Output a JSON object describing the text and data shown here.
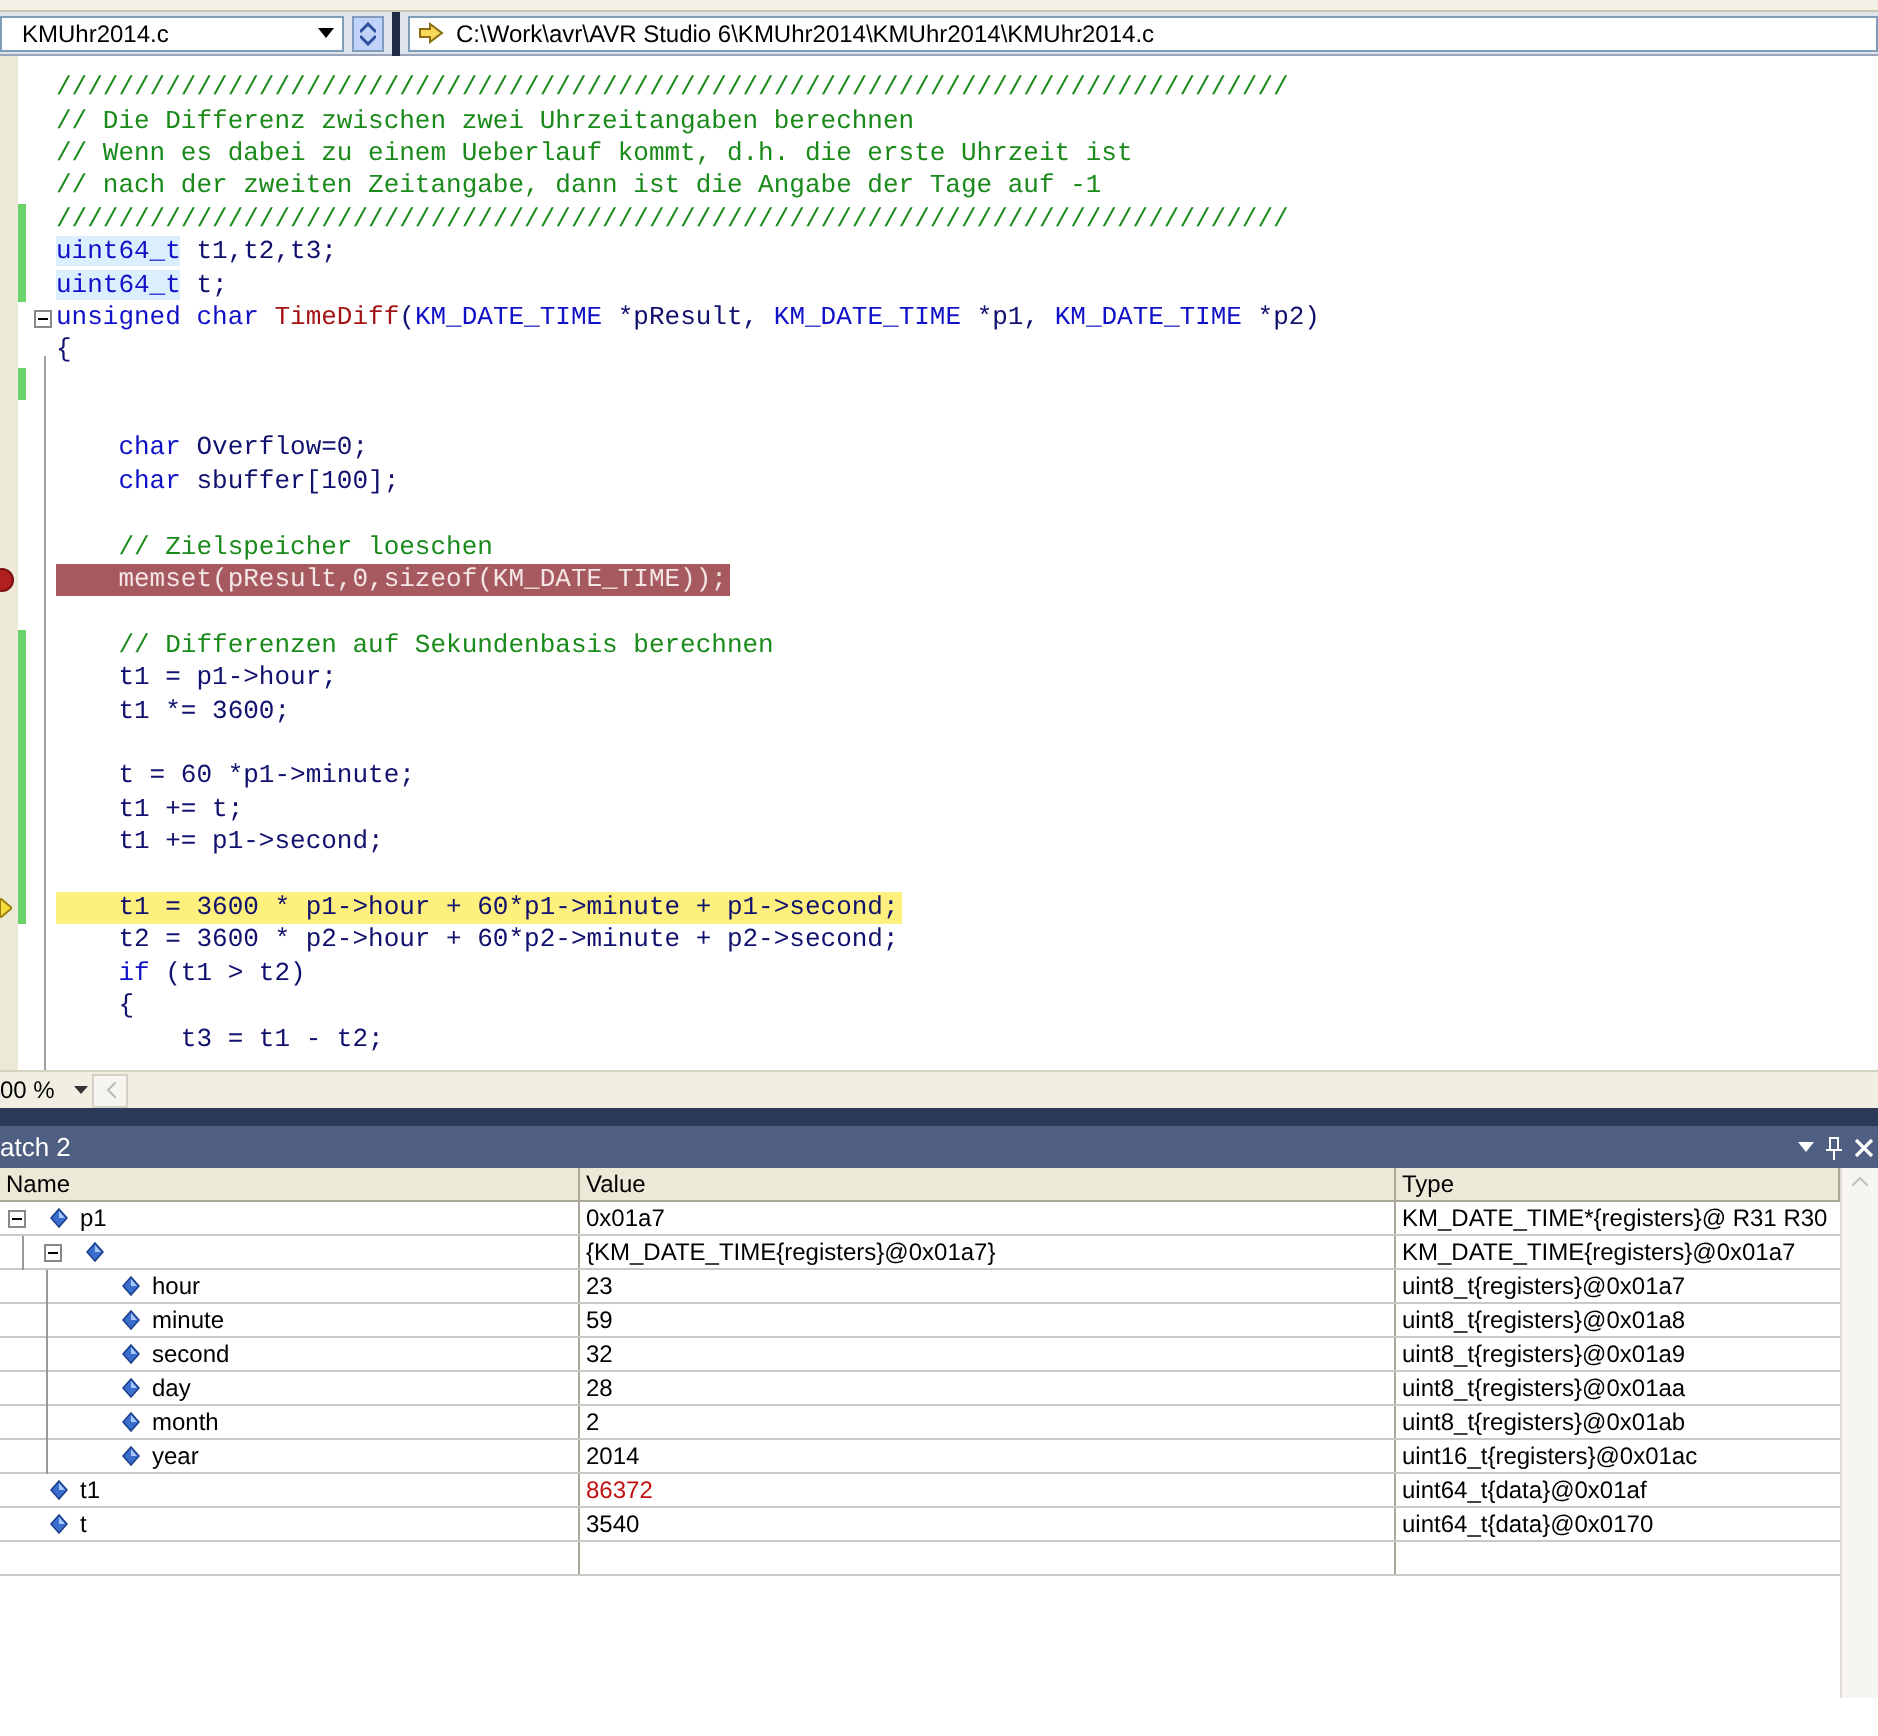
{
  "toolbar": {
    "file_dropdown": "KMUhr2014.c",
    "path": "C:\\Work\\avr\\AVR Studio 6\\KMUhr2014\\KMUhr2014\\KMUhr2014.c"
  },
  "editor": {
    "lines": [
      {
        "changed": false,
        "parts": [
          {
            "kind": "comment",
            "text": "///////////////////////////////////////////////////////////////////////////////"
          }
        ]
      },
      {
        "changed": false,
        "parts": [
          {
            "kind": "comment",
            "text": "// Die Differenz zwischen zwei Uhrzeitangaben berechnen"
          }
        ]
      },
      {
        "changed": false,
        "parts": [
          {
            "kind": "comment",
            "text": "// Wenn es dabei zu einem Ueberlauf kommt, d.h. die erste Uhrzeit ist"
          }
        ]
      },
      {
        "changed": false,
        "parts": [
          {
            "kind": "comment",
            "text": "// nach der zweiten Zeitangabe, dann ist die Angabe der Tage auf -1"
          }
        ]
      },
      {
        "changed": true,
        "parts": [
          {
            "kind": "comment",
            "text": "///////////////////////////////////////////////////////////////////////////////"
          }
        ]
      },
      {
        "changed": true,
        "parts": [
          {
            "kind": "type",
            "text": "uint64_t"
          },
          {
            "kind": "plain",
            "text": " t1,t2,t3;"
          }
        ]
      },
      {
        "changed": true,
        "parts": [
          {
            "kind": "type",
            "text": "uint64_t"
          },
          {
            "kind": "plain",
            "text": " t;"
          }
        ]
      },
      {
        "changed": false,
        "fold": true,
        "parts": [
          {
            "kind": "keyword",
            "text": "unsigned char "
          },
          {
            "kind": "function",
            "text": "TimeDiff"
          },
          {
            "kind": "plain",
            "text": "("
          },
          {
            "kind": "macro",
            "text": "KM_DATE_TIME"
          },
          {
            "kind": "plain",
            "text": " *pResult, "
          },
          {
            "kind": "macro",
            "text": "KM_DATE_TIME"
          },
          {
            "kind": "plain",
            "text": " *p1, "
          },
          {
            "kind": "macro",
            "text": "KM_DATE_TIME"
          },
          {
            "kind": "plain",
            "text": " *p2)"
          }
        ]
      },
      {
        "changed": false,
        "parts": [
          {
            "kind": "plain",
            "text": "{"
          }
        ]
      },
      {
        "changed": true
      },
      {
        "changed": false
      },
      {
        "changed": false,
        "parts": [
          {
            "kind": "keyword",
            "text": "    char"
          },
          {
            "kind": "plain",
            "text": " Overflow=0;"
          }
        ]
      },
      {
        "changed": false,
        "parts": [
          {
            "kind": "keyword",
            "text": "    char"
          },
          {
            "kind": "plain",
            "text": " sbuffer[100];"
          }
        ]
      },
      {
        "changed": false
      },
      {
        "changed": false,
        "parts": [
          {
            "kind": "comment",
            "text": "    // Zielspeicher loeschen"
          }
        ]
      },
      {
        "changed": false,
        "breakpoint": true,
        "parts": [
          {
            "kind": "plain",
            "text": "    memset(pResult,0,sizeof(KM_DATE_TIME));"
          }
        ]
      },
      {
        "changed": false
      },
      {
        "changed": true,
        "parts": [
          {
            "kind": "comment",
            "text": "    // Differenzen auf Sekundenbasis berechnen"
          }
        ]
      },
      {
        "changed": true,
        "parts": [
          {
            "kind": "plain",
            "text": "    t1 = p1->hour;"
          }
        ]
      },
      {
        "changed": true,
        "parts": [
          {
            "kind": "plain",
            "text": "    t1 *= 3600;"
          }
        ]
      },
      {
        "changed": true
      },
      {
        "changed": true,
        "parts": [
          {
            "kind": "plain",
            "text": "    t = 60 *p1->minute;"
          }
        ]
      },
      {
        "changed": true,
        "parts": [
          {
            "kind": "plain",
            "text": "    t1 += t;"
          }
        ]
      },
      {
        "changed": true,
        "parts": [
          {
            "kind": "plain",
            "text": "    t1 += p1->second;"
          }
        ]
      },
      {
        "changed": true
      },
      {
        "changed": true,
        "current": true,
        "parts": [
          {
            "kind": "plain",
            "text": "    t1 = 3600 * p1->hour + 60*p1->minute + p1->second;"
          }
        ]
      },
      {
        "changed": false,
        "parts": [
          {
            "kind": "plain",
            "text": "    t2 = 3600 * p2->hour + 60*p2->minute + p2->second;"
          }
        ]
      },
      {
        "changed": false,
        "parts": [
          {
            "kind": "keyword",
            "text": "    if"
          },
          {
            "kind": "plain",
            "text": " (t1 > t2)"
          }
        ]
      },
      {
        "changed": false,
        "parts": [
          {
            "kind": "plain",
            "text": "    {"
          }
        ]
      },
      {
        "changed": false,
        "parts": [
          {
            "kind": "plain",
            "text": "        t3 = t1 - t2;"
          }
        ]
      }
    ]
  },
  "zoom": "00 %",
  "watch": {
    "title": "atch 2",
    "columns": [
      "Name",
      "Value",
      "Type"
    ],
    "rows": [
      {
        "name": "p1",
        "value": "0x01a7",
        "type": "KM_DATE_TIME*{registers}@ R31 R30",
        "changed": false,
        "expanded": true,
        "children": [
          {
            "value": "{KM_DATE_TIME{registers}@0x01a7}",
            "type": "KM_DATE_TIME{registers}@0x01a7",
            "changed": false,
            "expanded": true,
            "children": [
              {
                "name": "hour",
                "value": "23",
                "type": "uint8_t{registers}@0x01a7",
                "changed": false
              },
              {
                "name": "minute",
                "value": "59",
                "type": "uint8_t{registers}@0x01a8",
                "changed": false
              },
              {
                "name": "second",
                "value": "32",
                "type": "uint8_t{registers}@0x01a9",
                "changed": false
              },
              {
                "name": "day",
                "value": "28",
                "type": "uint8_t{registers}@0x01aa",
                "changed": false
              },
              {
                "name": "month",
                "value": "2",
                "type": "uint8_t{registers}@0x01ab",
                "changed": false
              },
              {
                "name": "year",
                "value": "2014",
                "type": "uint16_t{registers}@0x01ac",
                "changed": false
              }
            ]
          }
        ]
      },
      {
        "name": "t1",
        "value": "86372",
        "type": "uint64_t{data}@0x01af",
        "changed": true
      },
      {
        "name": "t",
        "value": "3540",
        "type": "uint64_t{data}@0x0170",
        "changed": false
      }
    ]
  }
}
